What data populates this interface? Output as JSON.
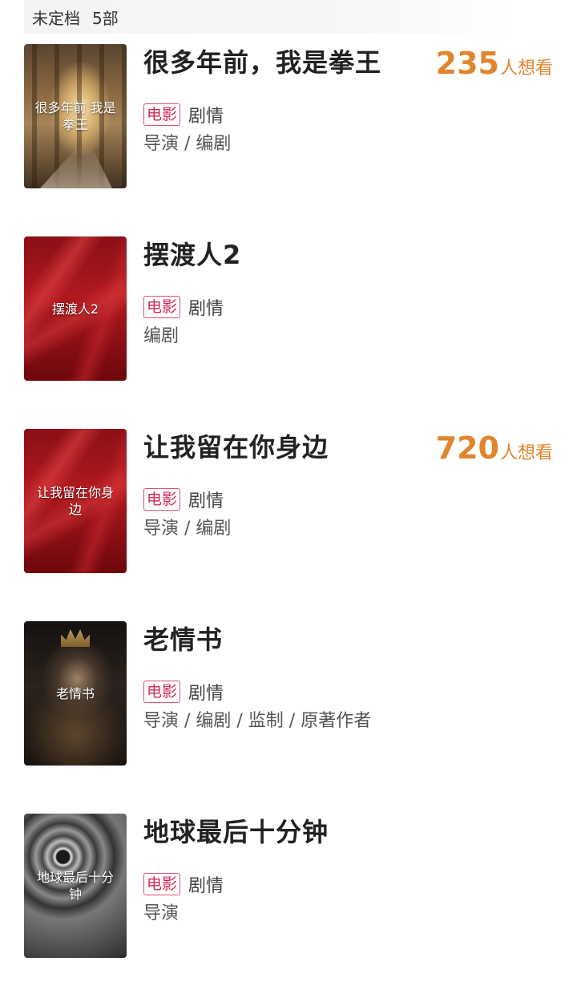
{
  "section": {
    "label": "未定档",
    "count": "5部"
  },
  "movies": [
    {
      "title": "很多年前，我是拳王",
      "poster_text": "很多年前 我是拳王",
      "tag": "电影",
      "genre": "剧情",
      "roles": "导演 / 编剧",
      "want_count": "235",
      "want_suffix": "人想看"
    },
    {
      "title": "摆渡人2",
      "poster_text": "摆渡人2",
      "tag": "电影",
      "genre": "剧情",
      "roles": "编剧",
      "want_count": "",
      "want_suffix": ""
    },
    {
      "title": "让我留在你身边",
      "poster_text": "让我留在你身边",
      "tag": "电影",
      "genre": "剧情",
      "roles": "导演 / 编剧",
      "want_count": "720",
      "want_suffix": "人想看"
    },
    {
      "title": "老情书",
      "poster_text": "老情书",
      "tag": "电影",
      "genre": "剧情",
      "roles": "导演 / 编剧 / 监制 / 原著作者",
      "want_count": "",
      "want_suffix": ""
    },
    {
      "title": "地球最后十分钟",
      "poster_text": "地球最后十分钟",
      "tag": "电影",
      "genre": "剧情",
      "roles": "导演",
      "want_count": "",
      "want_suffix": ""
    }
  ],
  "colors": {
    "want_accent": "#e0852e",
    "tag_red": "#d02850"
  }
}
